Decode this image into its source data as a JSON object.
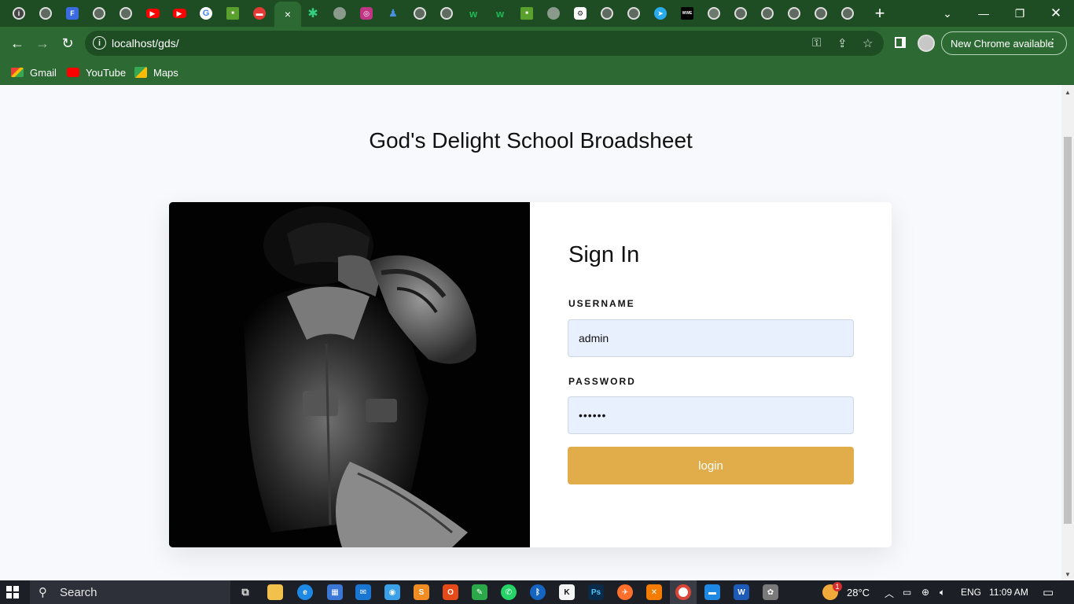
{
  "browser": {
    "active_tab_close": "×",
    "new_tab": "+",
    "url": "localhost/gds/",
    "update_button": "New Chrome available",
    "bookmarks": [
      "Gmail",
      "YouTube",
      "Maps"
    ],
    "tab_icons": [
      "chromium-icon",
      "chromium-icon",
      "forms-icon",
      "chromium-icon",
      "chromium-icon",
      "youtube-icon",
      "youtube-icon",
      "google-icon",
      "sim-icon",
      "shop-icon",
      "close-icon",
      "asterisk-icon",
      "globe-icon",
      "instagram-icon",
      "person-icon",
      "chromium-icon",
      "chromium-icon",
      "w-icon",
      "w-icon",
      "sim-icon",
      "globe-icon",
      "robot-icon",
      "chromium-icon",
      "chromium-icon",
      "telegram-icon",
      "wwe-icon",
      "leaf-icon",
      "chromium-icon",
      "chromium-icon",
      "chromium-icon",
      "chromium-icon",
      "chromium-icon"
    ]
  },
  "page": {
    "title": "God's Delight School Broadsheet",
    "form": {
      "heading": "Sign In",
      "username_label": "USERNAME",
      "username_value": "admin",
      "password_label": "PASSWORD",
      "password_value": "••••••",
      "login_label": "login"
    }
  },
  "taskbar": {
    "search_placeholder": "Search",
    "weather": "28°C",
    "language": "ENG",
    "time": "11:09 AM",
    "notification_badge": "1"
  },
  "colors": {
    "chrome_dark": "#1e4d24",
    "chrome_toolbar": "#2d6a33",
    "login_button": "#e1ad4a",
    "input_bg": "#e8f0fe"
  }
}
